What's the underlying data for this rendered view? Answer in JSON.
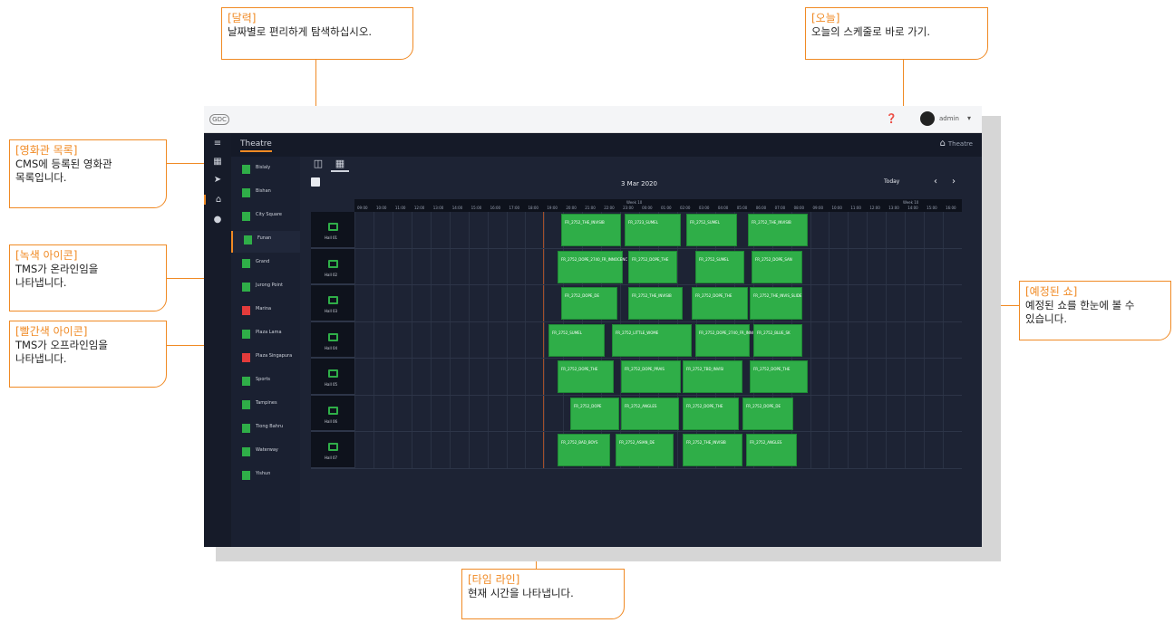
{
  "callouts": {
    "calendar": {
      "title": "[달력]",
      "desc": "날짜별로 편리하게 탐색하십시오."
    },
    "today": {
      "title": "[오늘]",
      "desc": "오늘의 스케줄로 바로 가기."
    },
    "theatre_list": {
      "title": "[영화관 목록]",
      "desc1": "CMS에 등록된 영화관",
      "desc2": "목록입니다."
    },
    "green_icon": {
      "title": "[녹색 아이콘]",
      "desc1": "TMS가 온라인임을",
      "desc2": "나타냅니다."
    },
    "red_icon": {
      "title": "[빨간색 아이콘]",
      "desc1": "TMS가 오프라인임을",
      "desc2": "나타냅니다."
    },
    "scheduled": {
      "title": "[예정된 쇼]",
      "desc1": "예정된 쇼를 한눈에 볼 수",
      "desc2": "있습니다."
    },
    "timeline": {
      "title": "[타임 라인]",
      "desc": "현재 시간을 나타냅니다."
    }
  },
  "app": {
    "logo": "GDC",
    "user_name": "admin",
    "breadcrumb_title": "Theatre",
    "breadcrumb_right": "Theatre",
    "date": "3 Mar 2020",
    "today_label": "Today",
    "prev": "‹",
    "next": "›",
    "footer": "",
    "colors": {
      "online": "#2fae48",
      "offline": "#e33b3b",
      "accent": "#f08a24",
      "now_line": "#a24e2a"
    }
  },
  "theatres": [
    {
      "name": "Bislaly",
      "status": "online"
    },
    {
      "name": "Bishan",
      "status": "online"
    },
    {
      "name": "City Square",
      "status": "online"
    },
    {
      "name": "Funan",
      "status": "online",
      "selected": true
    },
    {
      "name": "Grand",
      "status": "online"
    },
    {
      "name": "Jurong Point",
      "status": "online"
    },
    {
      "name": "Marina",
      "status": "offline"
    },
    {
      "name": "Plaza Lama",
      "status": "online"
    },
    {
      "name": "Plaza Singapura",
      "status": "offline"
    },
    {
      "name": "Sports",
      "status": "online"
    },
    {
      "name": "Tampines",
      "status": "online"
    },
    {
      "name": "Tiong Bahru",
      "status": "online"
    },
    {
      "name": "Waterway",
      "status": "online"
    },
    {
      "name": "Yishun",
      "status": "online"
    }
  ],
  "timeline": {
    "week_label_1": "Week 10",
    "week_label_2": "Week 10",
    "hours": [
      "09:00",
      "10:00",
      "11:00",
      "12:00",
      "13:00",
      "14:00",
      "15:00",
      "16:00",
      "17:00",
      "18:00",
      "19:00",
      "20:00",
      "21:00",
      "22:00",
      "23:00",
      "00:00",
      "01:00",
      "02:00",
      "03:00",
      "04:00",
      "05:00",
      "06:00",
      "07:00",
      "08:00",
      "09:00",
      "10:00",
      "11:00",
      "12:00",
      "13:00",
      "14:00",
      "15:00",
      "16:00"
    ]
  },
  "screens": [
    {
      "name": "Hall 01",
      "shows": [
        "FR_2752_THE_INVISIB",
        "FR_2723_SUMEL",
        "FR_2752_SUMEL",
        "FR_2752_THE_INVISIB"
      ]
    },
    {
      "name": "Hall 02",
      "shows": [
        "FR_2752_DOPE_2740_FR_INNOCENC",
        "FR_2752_DOPE_THE",
        "FR_2752_SUMEL",
        "FR_2752_DOPE_SAN"
      ]
    },
    {
      "name": "Hall 03",
      "shows": [
        "FR_2752_DOPE_DE",
        "FR_2752_THE_INVISIB",
        "FR_2752_DOPE_THE",
        "FR_2752_THE_INVIS_SLIDE"
      ]
    },
    {
      "name": "Hall 04",
      "shows": [
        "FR_2752_SUMEL",
        "FR_2752_LITTLE_WOME",
        "FR_2752_DOPE_2740_FR_INNOCENCE",
        "FR_2752_BLUE_SK"
      ]
    },
    {
      "name": "Hall 05",
      "shows": [
        "FR_2752_DOPE_THE",
        "FR_2752_DOPE_PRAIS",
        "FR_2752_TBD_INVISI",
        "FR_2752_DOPE_THE"
      ]
    },
    {
      "name": "Hall 06",
      "shows": [
        "FR_2752_DOPE",
        "FR_2752_ANGLES",
        "FR_2752_DOPE_THE",
        "FR_2752_DOPE_DE"
      ]
    },
    {
      "name": "Hall 07",
      "shows": [
        "FR_2752_BAD_BOYS",
        "FR_2752_ASIAN_DE",
        "FR_2752_THE_INVISIB",
        "FR_2752_ANGLES"
      ]
    }
  ]
}
